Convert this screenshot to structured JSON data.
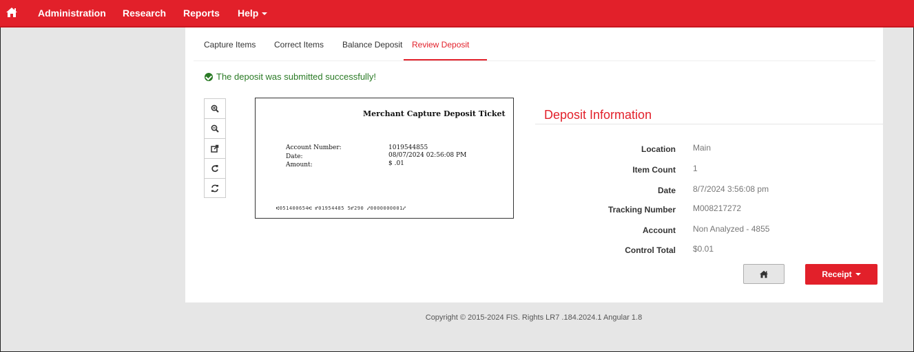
{
  "nav": {
    "home_icon": "home-icon",
    "items": [
      {
        "label": "Administration"
      },
      {
        "label": "Research"
      },
      {
        "label": "Reports"
      },
      {
        "label": "Help"
      }
    ]
  },
  "tabs": [
    {
      "label": "Capture Items"
    },
    {
      "label": "Correct Items"
    },
    {
      "label": "Balance Deposit"
    },
    {
      "label": "Review Deposit",
      "active": true
    }
  ],
  "alert": {
    "message": "The deposit was submitted successfully!",
    "icon": "check-circle-icon",
    "color": "#2a7a25"
  },
  "toolbar": {
    "icons": [
      "zoom-in-icon",
      "zoom-out-icon",
      "flip-icon",
      "rotate-right-icon",
      "refresh-icon"
    ]
  },
  "ticket": {
    "title": "Merchant Capture Deposit Ticket",
    "fields": [
      {
        "label": "Account Number:",
        "value": "1019544855"
      },
      {
        "label": "Date:",
        "value": "08/07/2024 02:56:08 PM"
      },
      {
        "label": "Amount:",
        "value": "$ .01"
      }
    ],
    "micr": "⑆051400654⑆  ⑈01954485 5⑈290  ⑇0000000001⑇"
  },
  "deposit_info": {
    "title": "Deposit Information",
    "rows": [
      {
        "label": "Location",
        "value": "Main"
      },
      {
        "label": "Item Count",
        "value": "1"
      },
      {
        "label": "Date",
        "value": "8/7/2024 3:56:08 pm"
      },
      {
        "label": "Tracking Number",
        "value": "M008217272"
      },
      {
        "label": "Account",
        "value": "Non Analyzed - 4855"
      },
      {
        "label": "Control Total",
        "value": "$0.01"
      }
    ]
  },
  "actions": {
    "home_icon": "home-icon",
    "receipt_label": "Receipt"
  },
  "footer": {
    "text": "Copyright © 2015-2024 FIS. Rights LR7 .184.2024.1 Angular 1.8"
  },
  "colors": {
    "brand_red": "#e2202a",
    "success_green": "#2a7a25"
  }
}
